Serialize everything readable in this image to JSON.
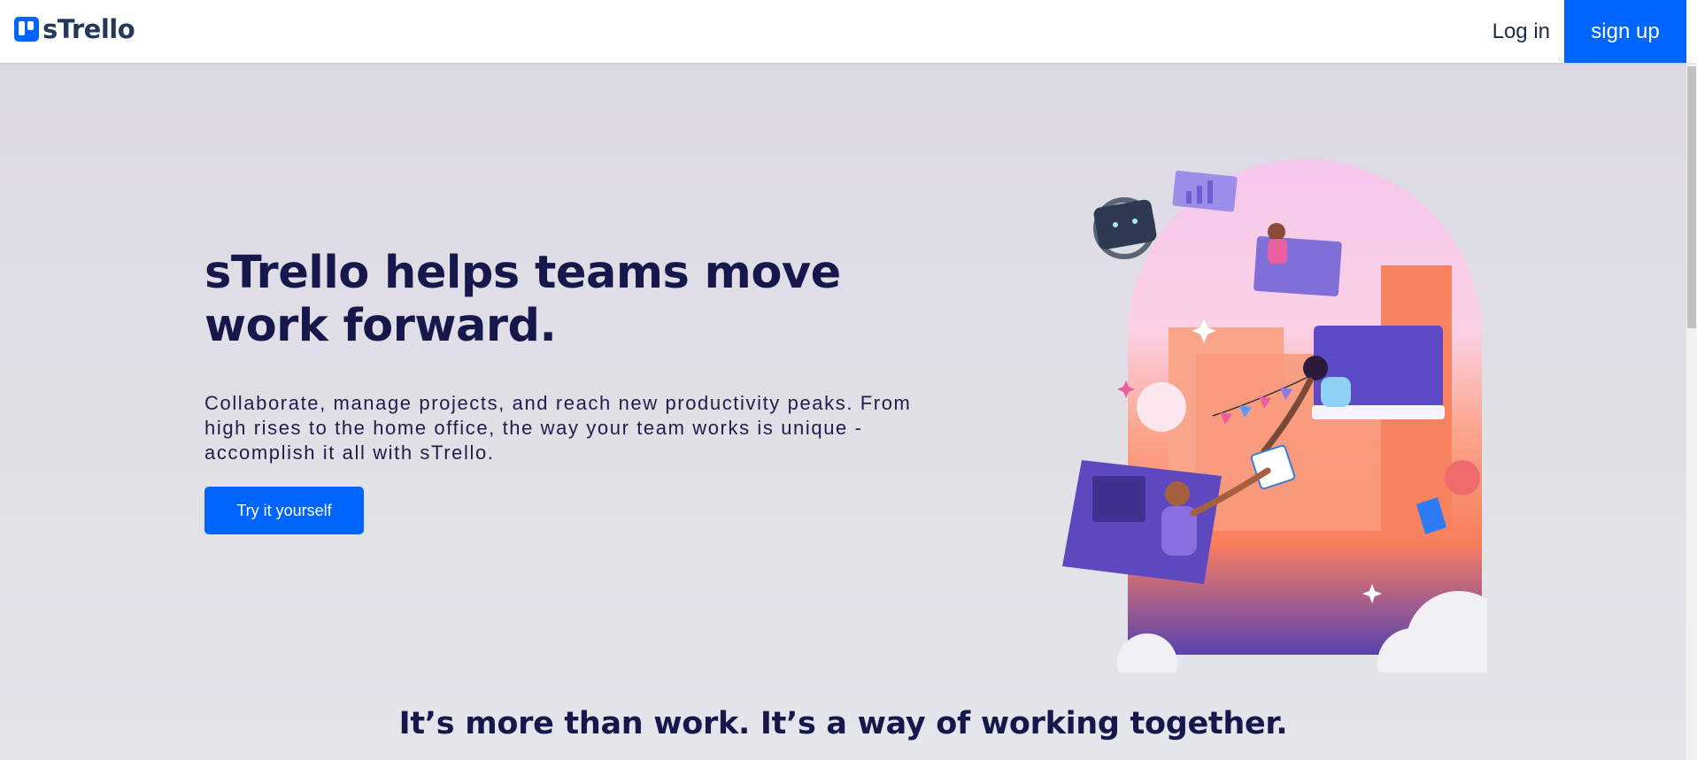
{
  "header": {
    "brand_name": "sTrello",
    "login_label": "Log in",
    "signup_label": "sign up"
  },
  "hero": {
    "headline": "sTrello helps teams move work forward.",
    "subtext": "Collaborate, manage projects, and reach new productivity peaks. From high rises to the home office, the way your team works is unique - accomplish it all with sTrello.",
    "cta_label": "Try it yourself"
  },
  "section": {
    "tagline": "It’s more than work. It’s a way of working together."
  },
  "colors": {
    "brand_blue": "#0065ff",
    "heading_navy": "#16174a",
    "hero_bg": "#dcd9e3"
  }
}
